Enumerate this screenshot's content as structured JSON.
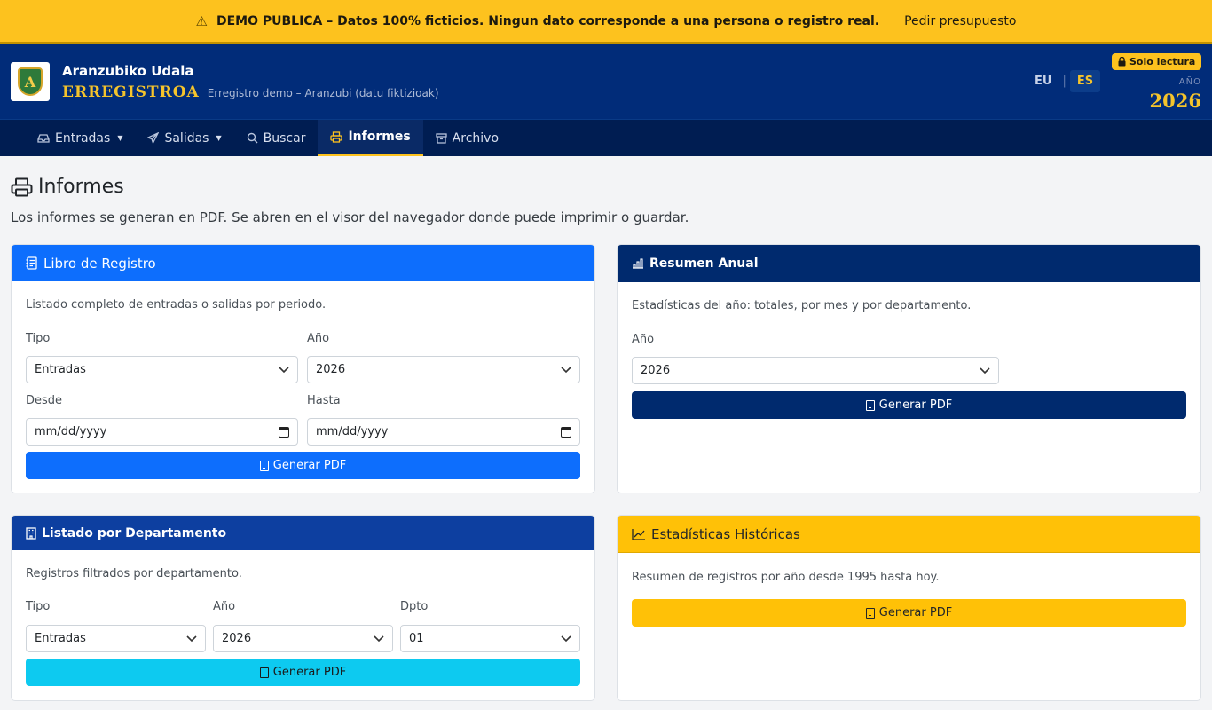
{
  "banner": {
    "message": "DEMO PUBLICA – Datos 100% ficticios. Ningun dato corresponde a una persona o registro real.",
    "link": "Pedir presupuesto"
  },
  "header": {
    "logo_letter": "A",
    "org": "Aranzubiko Udala",
    "app": "ERREGISTROA",
    "subtitle": "Erregistro demo – Aranzubi (datu fiktizioak)",
    "lang_eu": "EU",
    "lang_sep": "|",
    "lang_es": "ES",
    "readonly": "Solo lectura",
    "year_label": "AÑO",
    "year": "2026"
  },
  "nav": {
    "entradas": "Entradas",
    "salidas": "Salidas",
    "buscar": "Buscar",
    "informes": "Informes",
    "archivo": "Archivo"
  },
  "page": {
    "title": "Informes",
    "intro": "Los informes se generan en PDF. Se abren en el visor del navegador donde puede imprimir o guardar."
  },
  "libro": {
    "title": "Libro de Registro",
    "desc": "Listado completo de entradas o salidas por periodo.",
    "tipo_label": "Tipo",
    "tipo_value": "Entradas",
    "ano_label": "Año",
    "ano_value": "2026",
    "desde_label": "Desde",
    "desde_value": "mm/dd/yyyy",
    "hasta_label": "Hasta",
    "hasta_value": "mm/dd/yyyy",
    "button": "Generar PDF",
    "color": "#0d6efd"
  },
  "resumen": {
    "title": "Resumen Anual",
    "desc": "Estadísticas del año: totales, por mes y por departamento.",
    "ano_label": "Año",
    "ano_value": "2026",
    "button": "Generar PDF",
    "color": "#002a6e"
  },
  "departamento": {
    "title": "Listado por Departamento",
    "desc": "Registros filtrados por departamento.",
    "tipo_label": "Tipo",
    "tipo_value": "Entradas",
    "ano_label": "Año",
    "ano_value": "2026",
    "dpto_label": "Dpto",
    "dpto_value": "01",
    "button": "Generar PDF",
    "color": "#0d3fa0",
    "button_color": "#0dcaf0"
  },
  "historicas": {
    "title": "Estadísticas Históricas",
    "desc": "Resumen de registros por año desde 1995 hasta hoy.",
    "button": "Generar PDF",
    "color": "#ffc107"
  }
}
